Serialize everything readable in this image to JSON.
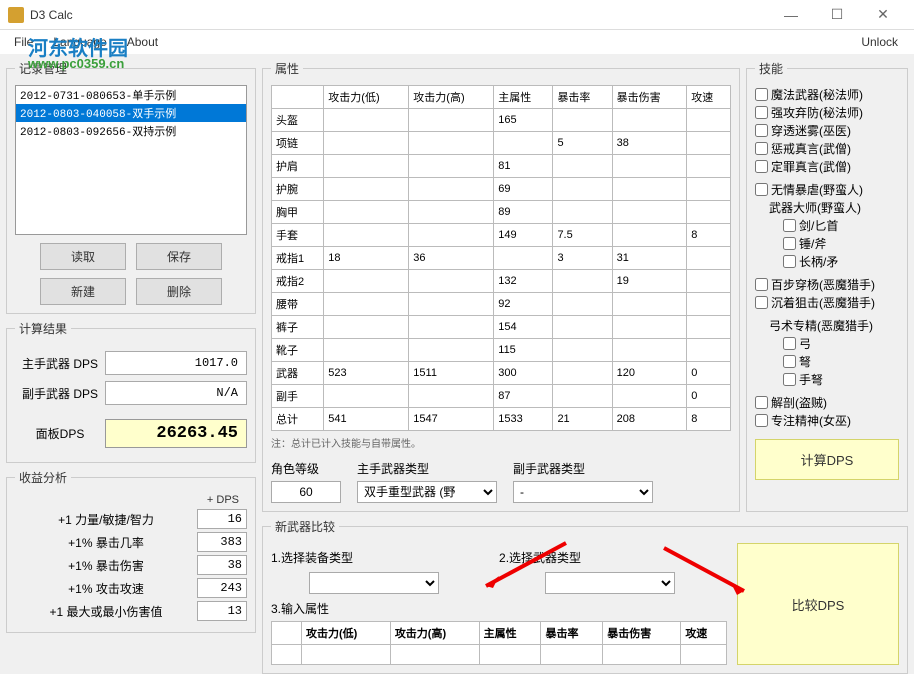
{
  "window": {
    "title": "D3 Calc",
    "unlock": "Unlock"
  },
  "menu": {
    "file": "File",
    "language": "Language",
    "about": "About"
  },
  "watermark": {
    "top": "河东软件园",
    "sub": "www.pc0359.cn"
  },
  "records": {
    "legend": "记录管理",
    "items": [
      "2012-0731-080653-单手示例",
      "2012-0803-040058-双手示例",
      "2012-0803-092656-双持示例"
    ],
    "selected": 1,
    "btn_read": "读取",
    "btn_save": "保存",
    "btn_new": "新建",
    "btn_del": "删除"
  },
  "results": {
    "legend": "计算结果",
    "main_label": "主手武器 DPS",
    "main_val": "1017.0",
    "off_label": "副手武器 DPS",
    "off_val": "N/A",
    "panel_label": "面板DPS",
    "panel_val": "26263.45"
  },
  "profit": {
    "legend": "收益分析",
    "header": "+ DPS",
    "rows": [
      {
        "label": "+1  力量/敏捷/智力",
        "val": "16"
      },
      {
        "label": "+1%  暴击几率",
        "val": "383"
      },
      {
        "label": "+1%  暴击伤害",
        "val": "38"
      },
      {
        "label": "+1%  攻击攻速",
        "val": "243"
      },
      {
        "label": "+1  最大或最小伤害值",
        "val": "13"
      }
    ]
  },
  "attr": {
    "legend": "属性",
    "headers": [
      "",
      "攻击力(低)",
      "攻击力(高)",
      "主属性",
      "暴击率",
      "暴击伤害",
      "攻速"
    ],
    "rows": [
      {
        "name": "头盔",
        "v": [
          "",
          "",
          "165",
          "",
          "",
          ""
        ]
      },
      {
        "name": "项链",
        "v": [
          "",
          "",
          "",
          "5",
          "38",
          ""
        ]
      },
      {
        "name": "护肩",
        "v": [
          "",
          "",
          "81",
          "",
          "",
          ""
        ]
      },
      {
        "name": "护腕",
        "v": [
          "",
          "",
          "69",
          "",
          "",
          ""
        ]
      },
      {
        "name": "胸甲",
        "v": [
          "",
          "",
          "89",
          "",
          "",
          ""
        ]
      },
      {
        "name": "手套",
        "v": [
          "",
          "",
          "149",
          "7.5",
          "",
          "8"
        ]
      },
      {
        "name": "戒指1",
        "v": [
          "18",
          "36",
          "",
          "3",
          "31",
          ""
        ]
      },
      {
        "name": "戒指2",
        "v": [
          "",
          "",
          "132",
          "",
          "19",
          ""
        ]
      },
      {
        "name": "腰带",
        "v": [
          "",
          "",
          "92",
          "",
          "",
          ""
        ]
      },
      {
        "name": "裤子",
        "v": [
          "",
          "",
          "154",
          "",
          "",
          ""
        ]
      },
      {
        "name": "靴子",
        "v": [
          "",
          "",
          "115",
          "",
          "",
          ""
        ]
      },
      {
        "name": "武器",
        "v": [
          "523",
          "1511",
          "300",
          "",
          "120",
          "0"
        ]
      },
      {
        "name": "副手",
        "v": [
          "",
          "",
          "87",
          "",
          "",
          "0"
        ]
      },
      {
        "name": "总计",
        "v": [
          "541",
          "1547",
          "1533",
          "21",
          "208",
          "8"
        ]
      }
    ],
    "note": "注：总计已计入技能与自带属性。",
    "level_label": "角色等级",
    "level_val": "60",
    "main_type_label": "主手武器类型",
    "main_type_val": "双手重型武器 (野",
    "off_type_label": "副手武器类型",
    "off_type_val": "-"
  },
  "skills": {
    "legend": "技能",
    "items": [
      {
        "label": "魔法武器(秘法师)",
        "indent": 0
      },
      {
        "label": "强攻弃防(秘法师)",
        "indent": 0
      },
      {
        "label": "穿透迷雾(巫医)",
        "indent": 0
      },
      {
        "label": "惩戒真言(武僧)",
        "indent": 0
      },
      {
        "label": "定罪真言(武僧)",
        "indent": 0
      },
      {
        "label": "无情暴虐(野蛮人)",
        "indent": 0,
        "gap": true
      },
      {
        "label": "武器大师(野蛮人)",
        "indent": 1,
        "nochk": true
      },
      {
        "label": "剑/匕首",
        "indent": 2
      },
      {
        "label": "锤/斧",
        "indent": 2
      },
      {
        "label": "长柄/矛",
        "indent": 2
      },
      {
        "label": "百步穿杨(恶魔猎手)",
        "indent": 0,
        "gap": true
      },
      {
        "label": "沉着狙击(恶魔猎手)",
        "indent": 0
      },
      {
        "label": "弓术专精(恶魔猎手)",
        "indent": 1,
        "nochk": true,
        "gap": true
      },
      {
        "label": "弓",
        "indent": 2
      },
      {
        "label": "弩",
        "indent": 2
      },
      {
        "label": "手弩",
        "indent": 2
      },
      {
        "label": "解剖(盗贼)",
        "indent": 0,
        "gap": true
      },
      {
        "label": "专注精神(女巫)",
        "indent": 0
      }
    ],
    "calc_btn": "计算DPS"
  },
  "compare": {
    "legend": "新武器比较",
    "step1": "1.选择装备类型",
    "step2": "2.选择武器类型",
    "step3": "3.输入属性",
    "headers": [
      "攻击力(低)",
      "攻击力(高)",
      "主属性",
      "暴击率",
      "暴击伤害",
      "攻速"
    ],
    "btn": "比较DPS"
  }
}
